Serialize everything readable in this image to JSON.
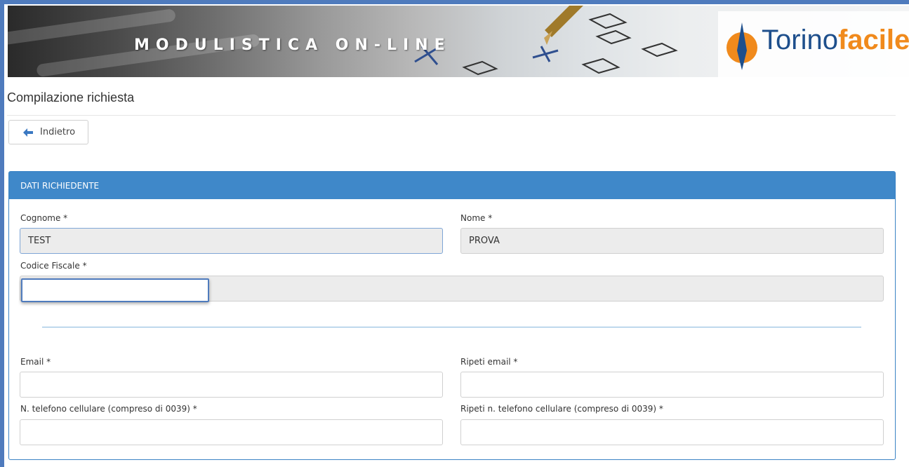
{
  "banner": {
    "title": "MODULISTICA ON-LINE",
    "logo_part1": "Torino",
    "logo_part2": "facile"
  },
  "page_title": "Compilazione richiesta",
  "back_button": {
    "label": "Indietro",
    "icon": "arrow-left-icon"
  },
  "panel": {
    "heading": "DATI RICHIEDENTE",
    "fields": {
      "cognome": {
        "label": "Cognome *",
        "value": "TEST"
      },
      "nome": {
        "label": "Nome *",
        "value": "PROVA"
      },
      "codice_fiscale": {
        "label": "Codice Fiscale *",
        "value": ""
      },
      "email": {
        "label": "Email *",
        "value": ""
      },
      "ripeti_email": {
        "label": "Ripeti email *",
        "value": ""
      },
      "telefono": {
        "label": "N. telefono cellulare (compreso di 0039) *",
        "value": ""
      },
      "ripeti_telefono": {
        "label": "Ripeti n. telefono cellulare (compreso di 0039) *",
        "value": ""
      }
    }
  },
  "colors": {
    "accent": "#3f88c9",
    "logo_blue": "#1e4f8c",
    "logo_orange": "#f08a1c"
  }
}
